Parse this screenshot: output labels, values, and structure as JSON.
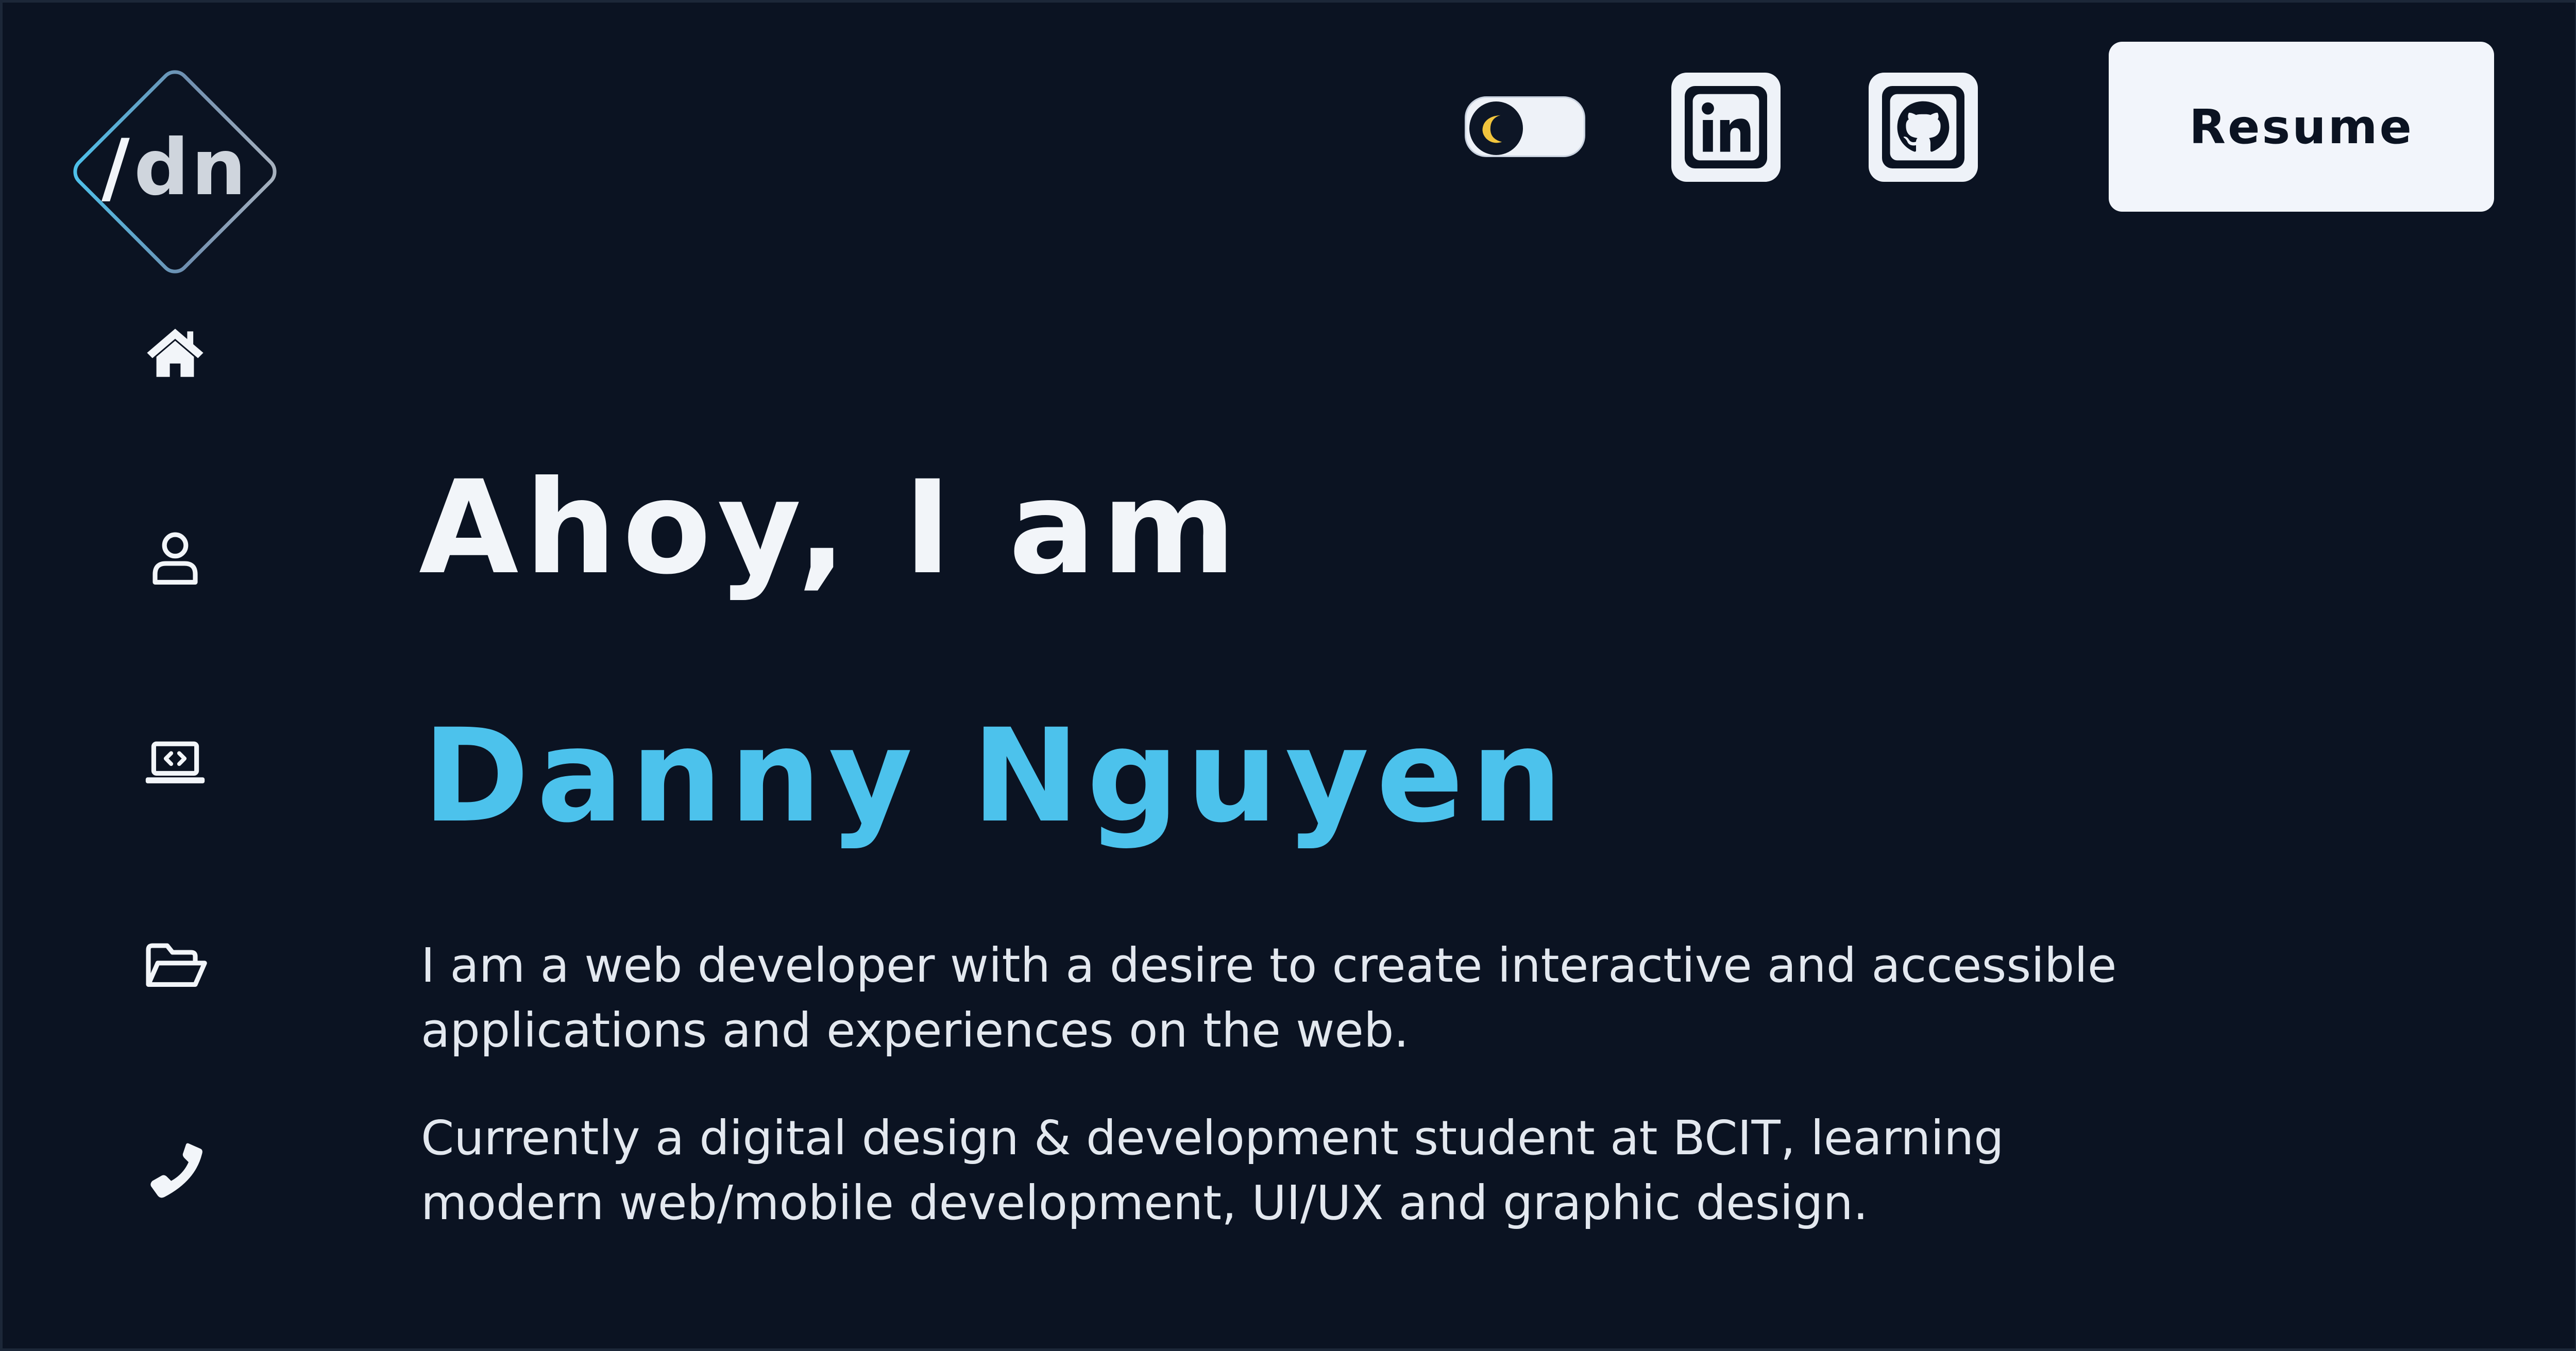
{
  "logo": {
    "slash": "/",
    "initials": "dn",
    "gradient": [
      "#4cc2ec",
      "#9aa7b8"
    ]
  },
  "sidebar": {
    "items": [
      {
        "id": "home",
        "icon": "home-icon"
      },
      {
        "id": "about",
        "icon": "user-icon"
      },
      {
        "id": "skills",
        "icon": "laptop-code-icon"
      },
      {
        "id": "projects",
        "icon": "folder-open-icon"
      },
      {
        "id": "contact",
        "icon": "phone-icon"
      }
    ]
  },
  "header": {
    "theme_toggle": {
      "state": "dark",
      "icon": "moon-icon"
    },
    "social": [
      {
        "id": "linkedin",
        "icon": "linkedin-icon"
      },
      {
        "id": "github",
        "icon": "github-icon"
      }
    ],
    "resume_label": "Resume"
  },
  "hero": {
    "greeting": "Ahoy, I am",
    "name": "Danny Nguyen",
    "paragraphs": [
      "I am a web developer with a desire to create interactive and accessible applications and experiences on the web.",
      "Currently a digital design & development student at BCIT, learning modern web/mobile development, UI/UX and graphic design."
    ]
  },
  "colors": {
    "background": "#0b1322",
    "accent": "#4cc2ec",
    "text": "#f2f5f9",
    "button_bg": "#f2f5fb"
  }
}
